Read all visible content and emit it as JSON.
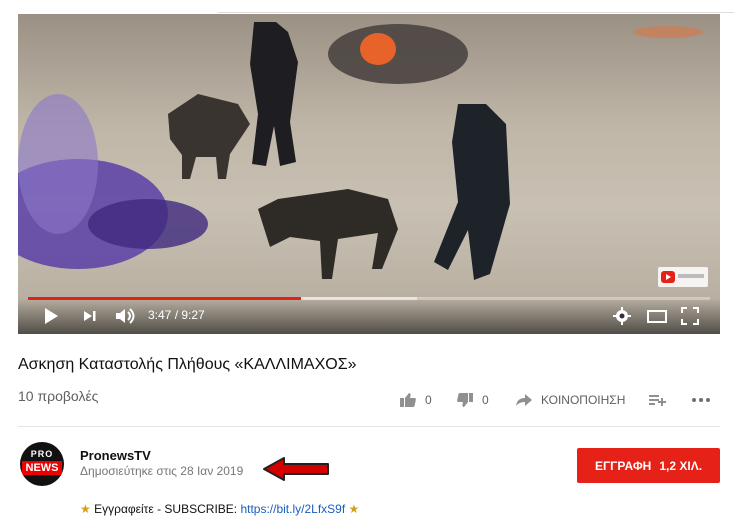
{
  "video": {
    "time_display": "3:47 / 9:27",
    "progress_fraction": 0.401,
    "buffer_fraction": 0.57
  },
  "title": "Ασκηση Καταστολής Πλήθους «ΚΑΛΛΙΜΑΧΟΣ»",
  "views": "10 προβολές",
  "actions": {
    "like_count": "0",
    "dislike_count": "0",
    "share_label": "ΚΟΙΝΟΠΟΙΗΣΗ"
  },
  "channel": {
    "avatar_top": "PRO",
    "avatar_bottom": "NEWS",
    "name": "PronewsTV",
    "published": "Δημοσιεύτηκε στις 28 Ιαν 2019"
  },
  "subscribe": {
    "label": "ΕΓΓΡΑΦΗ",
    "count": "1,2 ΧΙΛ."
  },
  "description": {
    "prefix": "Εγγραφείτε - SUBSCRIBE: ",
    "link": "https://bit.ly/2LfxS9f"
  },
  "colors": {
    "accent": "#e62117",
    "link": "#1a5ec1"
  }
}
